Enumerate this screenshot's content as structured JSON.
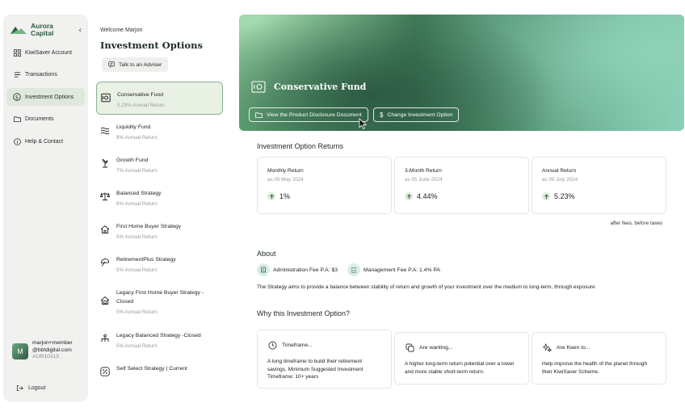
{
  "brand": {
    "line1": "Aurora",
    "line2": "Capital",
    "color": "#2f5a45"
  },
  "sidebar": {
    "collapse_icon": "chevron-left-icon",
    "items": [
      {
        "label": "KiwiSaver Account",
        "icon": "grid-icon"
      },
      {
        "label": "Transactions",
        "icon": "list-icon"
      },
      {
        "label": "Investment Options",
        "icon": "dollar-circle-icon"
      },
      {
        "label": "Documents",
        "icon": "folder-icon"
      },
      {
        "label": "Help & Contact",
        "icon": "info-circle-icon"
      }
    ],
    "active_index": 2,
    "user": {
      "avatar_initial": "M",
      "name": "marjon+member",
      "domain": "@bbtdigital.com",
      "id": "AUR10113"
    },
    "logout": "Logout"
  },
  "options": {
    "welcome": "Welcome Marjon",
    "title": "Investment Options",
    "adviser_button": "Talk to an Adviser",
    "funds": [
      {
        "name": "Conservative Fund",
        "rate": "5.23% Annual Return",
        "icon": "safe-icon",
        "active": true
      },
      {
        "name": "Liquidity Fund",
        "rate": "8% Annual Return",
        "icon": "waves-icon"
      },
      {
        "name": "Growth Fund",
        "rate": "7% Annual Return",
        "icon": "sprout-icon"
      },
      {
        "name": "Balanced Strategy",
        "rate": "6% Annual Return",
        "icon": "scales-icon"
      },
      {
        "name": "First Home Buyer Strategy",
        "rate": "5% Annual Return",
        "icon": "house-icon"
      },
      {
        "name": "RetirementPlus Strategy",
        "rate": "5% Annual Return",
        "icon": "umbrella-icon"
      },
      {
        "name_line1": "Legacy First Home Buyer Strategy -",
        "name_line2": "Closed",
        "rate": "5% Annual Return",
        "icon": "house-grid-icon"
      },
      {
        "name": "Legacy Balanced Strategy -Closed",
        "rate": "5% Annual Return",
        "icon": "hierarchy-icon"
      },
      {
        "name": "Self Select Strategy | Current",
        "rate": "",
        "icon": "percent-icon"
      }
    ]
  },
  "hero": {
    "title": "Conservative Fund",
    "icon": "safe-icon",
    "pds_button": "View the Product Disclosure Document",
    "change_button": "Change Investment Option"
  },
  "returns": {
    "heading": "Investment Option Returns",
    "cards": [
      {
        "label": "Monthly Return",
        "date": "as 05 May 2024",
        "value": "1%"
      },
      {
        "label": "3-Month Return",
        "date": "as 05 June 2024",
        "value": "4.44%"
      },
      {
        "label": "Annual Return",
        "date": "as 05 July 2024",
        "value": "5.23%"
      }
    ],
    "note": "after fees, before taxes"
  },
  "about": {
    "heading": "About",
    "admin_fee": "Administration Fee P.A: $3",
    "mgmt_fee": "Management Fee P.A: 1.4% PA",
    "description": "The Strategy aims to provide a balance between stability of return and growth of your investment over the medium to long-term, through exposure"
  },
  "why": {
    "heading": "Why this Investment Option?",
    "cards": [
      {
        "title": "Timeframe...",
        "icon": "clock-icon",
        "body": "A long timeframe to build their retirement savings. Minimum Suggested Investment Timeframe: 10+ years"
      },
      {
        "title": "Are wanting...",
        "icon": "coins-icon",
        "body": "A higher long-term return potential over a lower and more stable short-term return."
      },
      {
        "title": "Are Keen to...",
        "icon": "sparkle-icon",
        "body": "Help improve the health of the planet through their KiwiSaver Scheme."
      }
    ]
  },
  "colors": {
    "accent": "#3e7856",
    "active_bg": "#e8f1e4",
    "up_badge": "#dbead7"
  }
}
